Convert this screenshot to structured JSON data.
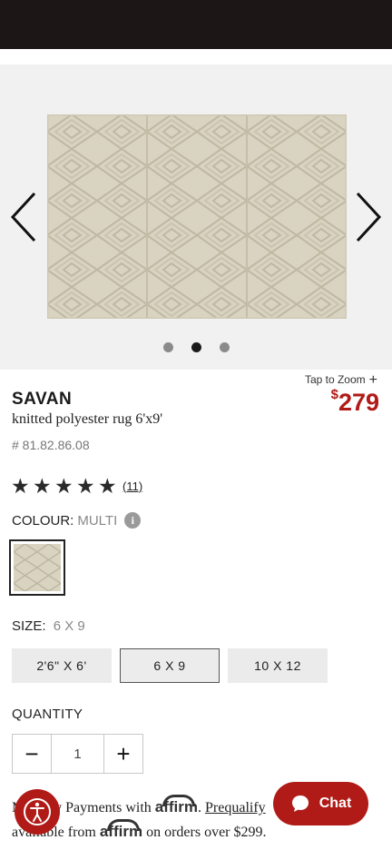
{
  "gallery": {
    "zoom_label": "Tap to Zoom",
    "zoom_symbol": "+",
    "active_slide_index": 2,
    "slide_count": 3
  },
  "product": {
    "brand": "SAVAN",
    "name": "knitted polyester rug 6'x9'",
    "sku": "# 81.82.86.08",
    "price_currency": "$",
    "price_amount": "279",
    "price_color": "#b01a17"
  },
  "rating": {
    "stars": 5,
    "reviews": "(11)"
  },
  "colour": {
    "label": "COLOUR:",
    "value": "MULTI",
    "info_glyph": "i"
  },
  "size": {
    "label": "SIZE:",
    "value": "6 X 9",
    "options": [
      "2'6\" X 6'",
      "6 X 9",
      "10 X 12"
    ],
    "selected_index": 1
  },
  "quantity": {
    "label": "QUANTITY",
    "value": "1",
    "minus": "−",
    "plus": "+"
  },
  "affirm": {
    "line1_prefix": "Monthly Payments with",
    "logo": "affirm",
    "line1_suffix": ".",
    "prequalify": "Prequalify",
    "line2_prefix": "available from",
    "line2_suffix": "on orders over $299.",
    "line3": "Prequalify"
  },
  "chat": {
    "label": "Chat"
  },
  "colors": {
    "accent": "#b01a17",
    "topbar": "#1c1616"
  }
}
